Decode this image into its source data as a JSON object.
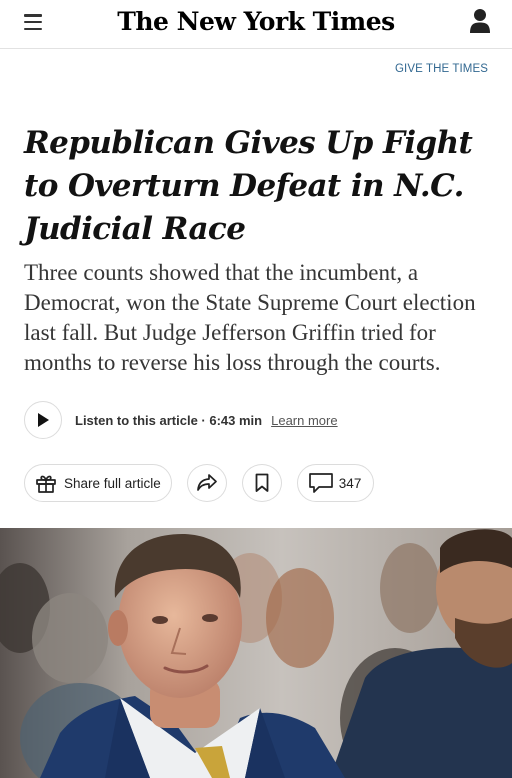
{
  "header": {
    "masthead": "The New York Times",
    "menu_icon": "hamburger-menu-icon",
    "account_icon": "account-icon"
  },
  "promo": {
    "give_label": "GIVE THE TIMES"
  },
  "article": {
    "headline": "Republican Gives Up Fight to Overturn Defeat in N.C. Judicial Race",
    "summary": "Three counts showed that the incumbent, a Democrat, won the State Supreme Court election last fall. But Judge Jefferson Griffin tried for months to reverse his loss through the courts."
  },
  "audio": {
    "label": "Listen to this article · 6:43 min",
    "link": "Learn more",
    "icon": "play-icon"
  },
  "actions": {
    "share_label": "Share full article",
    "share_icon": "gift-icon",
    "forward_icon": "share-arrow-icon",
    "bookmark_icon": "bookmark-icon",
    "comment_icon": "comment-icon",
    "comment_count": "347"
  },
  "colors": {
    "link_blue": "#326891",
    "text": "#121212",
    "suit_blue": "#1f3a6b",
    "tie_gold": "#c9a43a"
  }
}
